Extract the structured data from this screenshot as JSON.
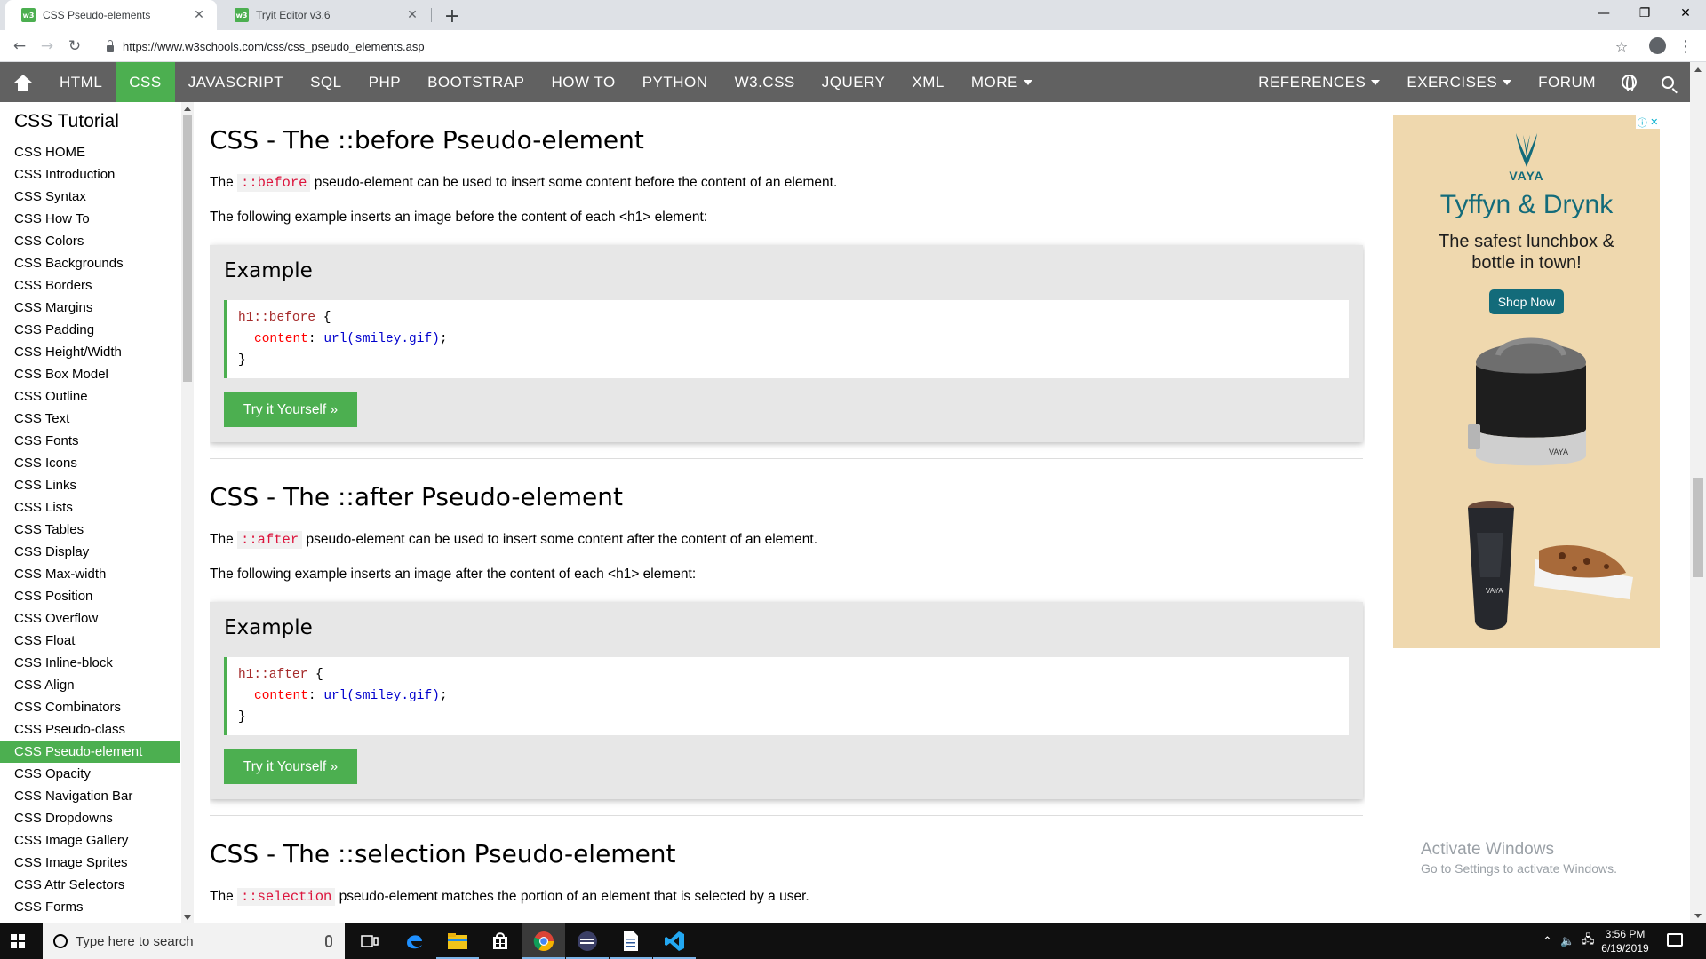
{
  "browser": {
    "tabs": [
      {
        "title": "CSS Pseudo-elements",
        "favicon_text": "w3",
        "active": true
      },
      {
        "title": "Tryit Editor v3.6",
        "favicon_text": "w3",
        "active": false
      }
    ],
    "url": "https://www.w3schools.com/css/css_pseudo_elements.asp",
    "icons": {
      "back": "back-arrow-icon",
      "forward": "forward-arrow-icon",
      "reload": "reload-icon",
      "bookmark": "star-icon",
      "menu": "kebab-menu-icon"
    }
  },
  "topnav": {
    "left": [
      "HTML",
      "CSS",
      "JAVASCRIPT",
      "SQL",
      "PHP",
      "BOOTSTRAP",
      "HOW TO",
      "PYTHON",
      "W3.CSS",
      "JQUERY",
      "XML",
      "MORE"
    ],
    "active": "CSS",
    "right": [
      "REFERENCES",
      "EXERCISES",
      "FORUM"
    ],
    "colors": {
      "bar": "#616161",
      "active": "#4CAF50"
    }
  },
  "sidebar": {
    "title": "CSS Tutorial",
    "items": [
      "CSS HOME",
      "CSS Introduction",
      "CSS Syntax",
      "CSS How To",
      "CSS Colors",
      "CSS Backgrounds",
      "CSS Borders",
      "CSS Margins",
      "CSS Padding",
      "CSS Height/Width",
      "CSS Box Model",
      "CSS Outline",
      "CSS Text",
      "CSS Fonts",
      "CSS Icons",
      "CSS Links",
      "CSS Lists",
      "CSS Tables",
      "CSS Display",
      "CSS Max-width",
      "CSS Position",
      "CSS Overflow",
      "CSS Float",
      "CSS Inline-block",
      "CSS Align",
      "CSS Combinators",
      "CSS Pseudo-class",
      "CSS Pseudo-element",
      "CSS Opacity",
      "CSS Navigation Bar",
      "CSS Dropdowns",
      "CSS Image Gallery",
      "CSS Image Sprites",
      "CSS Attr Selectors",
      "CSS Forms"
    ],
    "active": "CSS Pseudo-element"
  },
  "sections": [
    {
      "heading": "CSS - The ::before Pseudo-element",
      "intro_before": "The ",
      "code": "::before",
      "intro_after": " pseudo-element can be used to insert some content before the content of an element.",
      "desc": "The following example inserts an image before the content of each <h1> element:",
      "example_title": "Example",
      "code_lines": {
        "selector": "h1::before",
        "property": "content",
        "value": "url(smiley.gif)"
      },
      "button": "Try it Yourself »"
    },
    {
      "heading": "CSS - The ::after Pseudo-element",
      "intro_before": "The ",
      "code": "::after",
      "intro_after": " pseudo-element can be used to insert some content after the content of an element.",
      "desc": "The following example inserts an image after the content of each <h1> element:",
      "example_title": "Example",
      "code_lines": {
        "selector": "h1::after",
        "property": "content",
        "value": "url(smiley.gif)"
      },
      "button": "Try it Yourself »"
    },
    {
      "heading": "CSS - The ::selection Pseudo-element",
      "intro_before": "The ",
      "code": "::selection",
      "intro_after": " pseudo-element matches the portion of an element that is selected by a user."
    }
  ],
  "code_punct": {
    "open": " {",
    "colon": ":",
    "semi": ";",
    "close": "}"
  },
  "ad": {
    "brand": "VAYA",
    "headline": "Tyffyn & Drynk",
    "sub": "The safest lunchbox & bottle in town!",
    "cta": "Shop Now",
    "product_mark": "VAYA",
    "colors": {
      "bg": "#efd8ae",
      "teal": "#136b7a"
    }
  },
  "watermark": {
    "line1": "Activate Windows",
    "line2": "Go to Settings to activate Windows."
  },
  "taskbar": {
    "search_placeholder": "Type here to search",
    "time": "3:56 PM",
    "date": "6/19/2019"
  }
}
